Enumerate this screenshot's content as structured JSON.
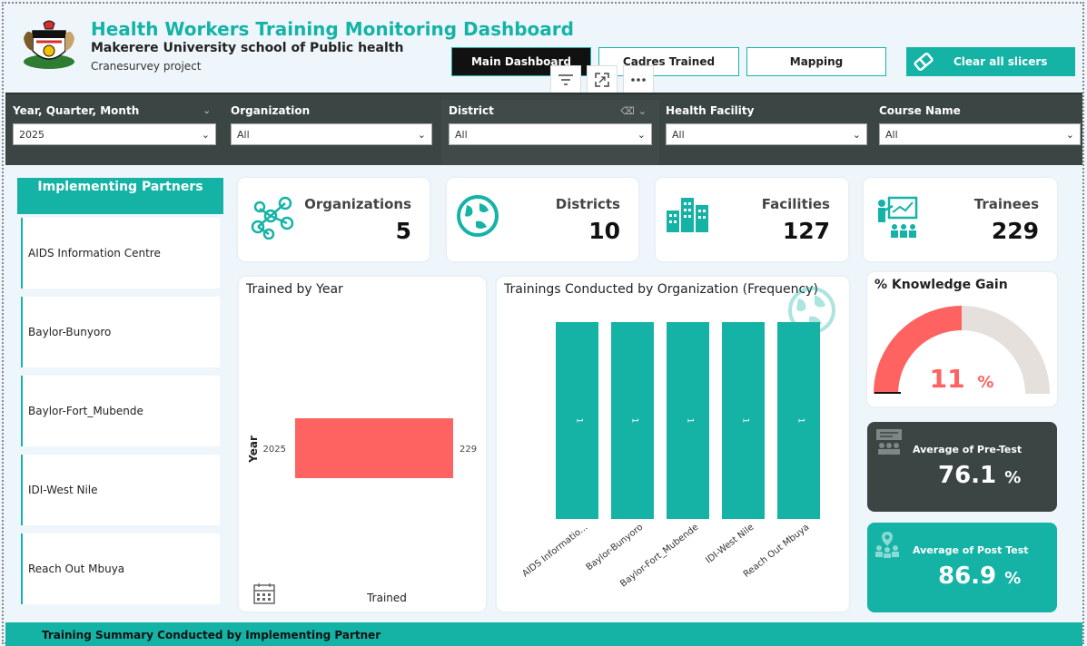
{
  "header": {
    "title": "Health Workers Training Monitoring Dashboard",
    "subtitle": "Makerere University school of Public health",
    "project": "Cranesurvey project"
  },
  "nav": {
    "main_dashboard": "Main Dashboard",
    "cadres_trained": "Cadres Trained",
    "mapping": "Mapping",
    "clear_slicers": "Clear all slicers"
  },
  "slicers": [
    {
      "label": "Year, Quarter, Month",
      "value": "2025"
    },
    {
      "label": "Organization",
      "value": "All"
    },
    {
      "label": "District",
      "value": "All"
    },
    {
      "label": "Health Facility",
      "value": "All"
    },
    {
      "label": "Course Name",
      "value": "All"
    }
  ],
  "partners": {
    "header": "Implementing Partners",
    "items": [
      "AIDS Information Centre",
      "Baylor-Bunyoro",
      "Baylor-Fort_Mubende",
      "IDI-West Nile",
      "Reach Out Mbuya"
    ]
  },
  "kpis": {
    "organizations": {
      "label": "Organizations",
      "value": "5"
    },
    "districts": {
      "label": "Districts",
      "value": "10"
    },
    "facilities": {
      "label": "Facilities",
      "value": "127"
    },
    "trainees": {
      "label": "Trainees",
      "value": "229"
    }
  },
  "trained_by_year": {
    "title": "Trained by Year",
    "ylabel": "Year",
    "xlabel": "Trained",
    "category_label": "2025",
    "value_label": "229"
  },
  "trainings_by_org": {
    "title": "Trainings Conducted by Organization (Frequency)"
  },
  "knowledge_gain": {
    "title": "% Knowledge Gain",
    "value": "11",
    "unit": "%"
  },
  "pre_test": {
    "label": "Average of Pre-Test",
    "value": "76.1",
    "unit": "%"
  },
  "post_test": {
    "label": "Average of Post Test",
    "value": "86.9",
    "unit": "%"
  },
  "footer": {
    "title": "Training Summary Conducted by Implementing Partner"
  },
  "colors": {
    "accent": "#15b3a6",
    "coral": "#ff6361",
    "dark": "#3a4544",
    "gauge_bg": "#e6e0dc"
  },
  "chart_data": [
    {
      "type": "bar",
      "orientation": "horizontal",
      "title": "Trained by Year",
      "xlabel": "Trained",
      "ylabel": "Year",
      "categories": [
        "2025"
      ],
      "values": [
        229
      ]
    },
    {
      "type": "bar",
      "title": "Trainings Conducted by Organization (Frequency)",
      "categories": [
        "AIDS Informatio...",
        "Baylor-Bunyoro",
        "Baylor-Fort_Mubende",
        "IDI-West Nile",
        "Reach Out Mbuya"
      ],
      "values": [
        1,
        1,
        1,
        1,
        1
      ],
      "data_labels": [
        "1",
        "1",
        "1",
        "1",
        "1"
      ]
    },
    {
      "type": "gauge",
      "title": "% Knowledge Gain",
      "value": 11,
      "max": 22
    }
  ]
}
